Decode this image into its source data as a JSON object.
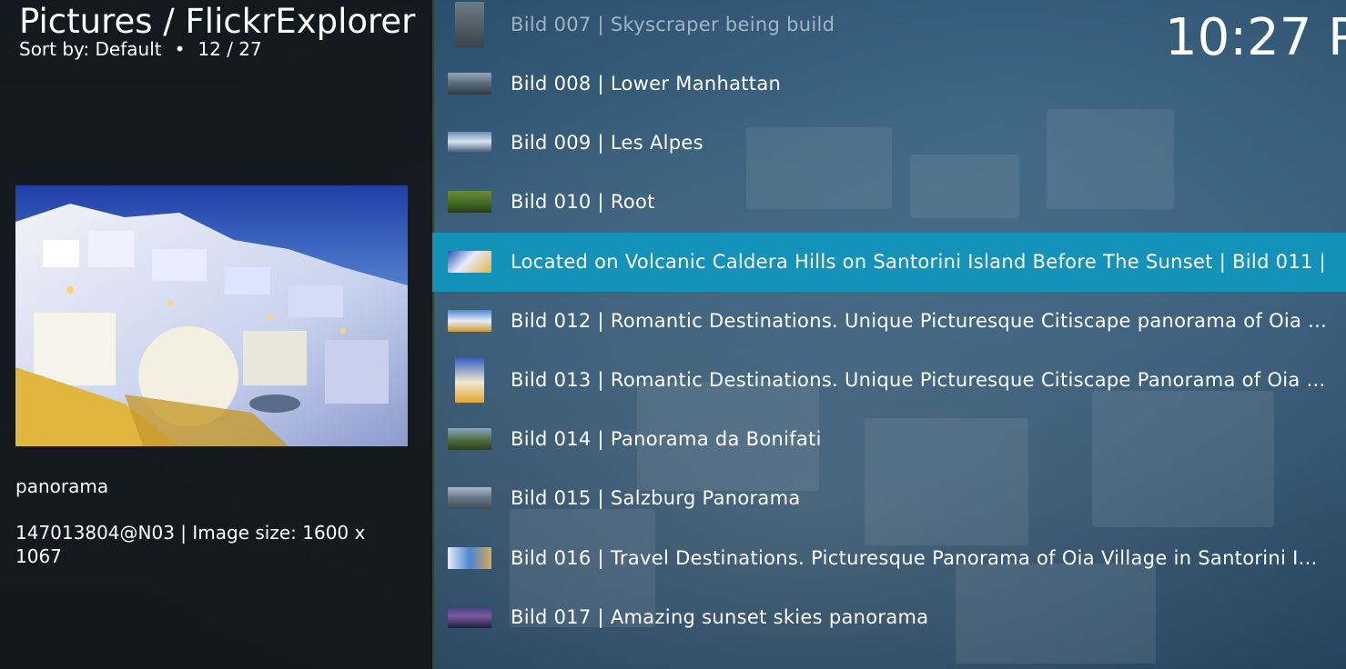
{
  "header": {
    "title": "Pictures / FlickrExplorer",
    "sort_label": "Sort by: Default",
    "separator": "•",
    "position": "12 / 27"
  },
  "clock": "10:27 P",
  "details": {
    "label": "panorama",
    "info": "147013804@N03 | Image size: 1600 x 1067"
  },
  "list": [
    {
      "text": "Bild 007 | Skyscraper being build",
      "thumb": "skyscraper",
      "state": "dim"
    },
    {
      "text": "Bild 008 | Lower Manhattan",
      "thumb": "city"
    },
    {
      "text": "Bild 009 | Les Alpes",
      "thumb": "mountains"
    },
    {
      "text": "Bild 010 | Root",
      "thumb": "grass"
    },
    {
      "text": "Located on Volcanic Caldera Hills on Santorini Island Before The Sunset | Bild 011 |",
      "thumb": "santorini",
      "state": "selected"
    },
    {
      "text": "Bild 012 | Romantic Destinations. Unique Picturesque Citiscape panorama of Oia ...",
      "thumb": "oia"
    },
    {
      "text": "Bild 013 | Romantic Destinations. Unique Picturesque Citiscape Panorama of Oia ...",
      "thumb": "oia-tall"
    },
    {
      "text": "Bild 014 | Panorama da Bonifati",
      "thumb": "hills"
    },
    {
      "text": "Bild 015 | Salzburg Panorama",
      "thumb": "salzburg"
    },
    {
      "text": "Bild 016 | Travel Destinations. Picturesque Panorama of Oia Village in Santorini I...",
      "thumb": "village"
    },
    {
      "text": "Bild 017 | Amazing sunset skies panorama",
      "thumb": "sunset"
    }
  ]
}
